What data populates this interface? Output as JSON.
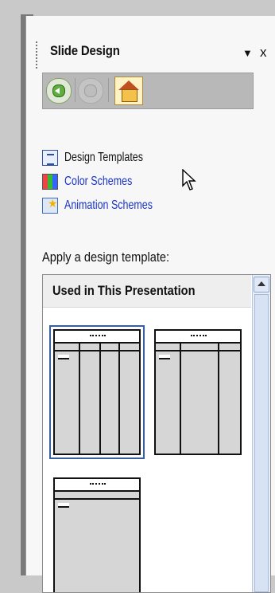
{
  "pane": {
    "title": "Slide Design",
    "dropdown_glyph": "▼",
    "close_glyph": "x"
  },
  "nav": {
    "back_icon": "back-arrow-icon",
    "forward_icon": "forward-arrow-icon",
    "home_icon": "home-icon"
  },
  "links": [
    {
      "label": "Design Templates",
      "icon": "design-templates-icon"
    },
    {
      "label": "Color Schemes",
      "icon": "color-schemes-icon"
    },
    {
      "label": "Animation Schemes",
      "icon": "animation-schemes-icon"
    }
  ],
  "section_label": "Apply a design template:",
  "gallery": {
    "header": "Used in This Presentation",
    "templates": [
      {
        "selected": true
      },
      {
        "selected": false
      },
      {
        "selected": false
      }
    ]
  },
  "colors": {
    "link": "#1a33c8",
    "pane_bg": "#f7f7f7",
    "selection_border": "#3a5f9e"
  }
}
